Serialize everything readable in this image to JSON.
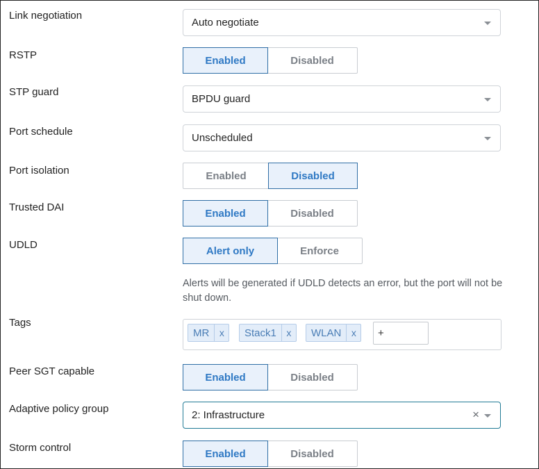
{
  "settings": {
    "link_negotiation": {
      "label": "Link negotiation",
      "value": "Auto negotiate"
    },
    "rstp": {
      "label": "RSTP",
      "options": [
        "Enabled",
        "Disabled"
      ],
      "selected": "Enabled"
    },
    "stp_guard": {
      "label": "STP guard",
      "value": "BPDU guard"
    },
    "port_schedule": {
      "label": "Port schedule",
      "value": "Unscheduled"
    },
    "port_isolation": {
      "label": "Port isolation",
      "options": [
        "Enabled",
        "Disabled"
      ],
      "selected": "Disabled"
    },
    "trusted_dai": {
      "label": "Trusted DAI",
      "options": [
        "Enabled",
        "Disabled"
      ],
      "selected": "Enabled"
    },
    "udld": {
      "label": "UDLD",
      "options": [
        "Alert only",
        "Enforce"
      ],
      "selected": "Alert only",
      "help_line1": "Alerts will be generated if UDLD detects an error, but the port will not be",
      "help_line2": "shut down."
    },
    "tags": {
      "label": "Tags",
      "items": [
        "MR",
        "Stack1",
        "WLAN"
      ],
      "remove_glyph": "x",
      "input_placeholder": "+"
    },
    "peer_sgt": {
      "label": "Peer SGT capable",
      "options": [
        "Enabled",
        "Disabled"
      ],
      "selected": "Enabled"
    },
    "adaptive_policy_group": {
      "label": "Adaptive policy group",
      "value": "2: Infrastructure",
      "clear_glyph": "×"
    },
    "storm_control": {
      "label": "Storm control",
      "options": [
        "Enabled",
        "Disabled"
      ],
      "selected": "Enabled"
    }
  },
  "colors": {
    "active_bg": "#e9f1fb",
    "active_text": "#2f79c4",
    "active_border": "#2f6ea5",
    "tag_bg": "#e3edf9",
    "focus_border": "#1f7a95"
  },
  "icons": {
    "select_caret": "chevron-down-icon",
    "clear": "close-icon",
    "tag_remove": "close-icon"
  }
}
